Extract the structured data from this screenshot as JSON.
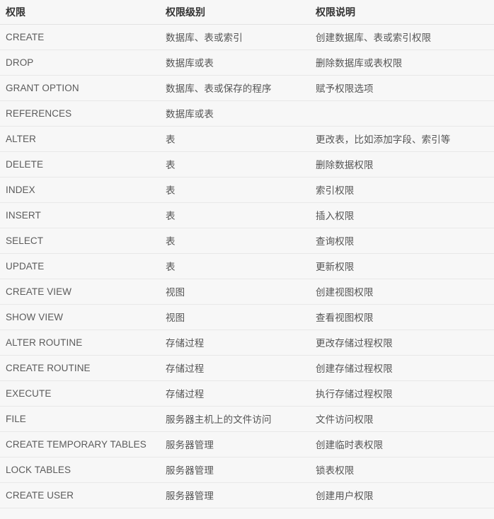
{
  "table": {
    "columns": [
      {
        "key": "privilege",
        "label": "权限"
      },
      {
        "key": "level",
        "label": "权限级别"
      },
      {
        "key": "description",
        "label": "权限说明"
      }
    ],
    "rows": [
      {
        "privilege": "CREATE",
        "level": "数据库、表或索引",
        "description": "创建数据库、表或索引权限"
      },
      {
        "privilege": "DROP",
        "level": "数据库或表",
        "description": "删除数据库或表权限"
      },
      {
        "privilege": "GRANT OPTION",
        "level": "数据库、表或保存的程序",
        "description": "赋予权限选项"
      },
      {
        "privilege": "REFERENCES",
        "level": "数据库或表",
        "description": ""
      },
      {
        "privilege": "ALTER",
        "level": "表",
        "description": "更改表，比如添加字段、索引等"
      },
      {
        "privilege": "DELETE",
        "level": "表",
        "description": "删除数据权限"
      },
      {
        "privilege": "INDEX",
        "level": "表",
        "description": "索引权限"
      },
      {
        "privilege": "INSERT",
        "level": "表",
        "description": "插入权限"
      },
      {
        "privilege": "SELECT",
        "level": "表",
        "description": "查询权限"
      },
      {
        "privilege": "UPDATE",
        "level": "表",
        "description": "更新权限"
      },
      {
        "privilege": "CREATE VIEW",
        "level": "视图",
        "description": "创建视图权限"
      },
      {
        "privilege": "SHOW VIEW",
        "level": "视图",
        "description": "查看视图权限"
      },
      {
        "privilege": "ALTER ROUTINE",
        "level": "存储过程",
        "description": "更改存储过程权限"
      },
      {
        "privilege": "CREATE ROUTINE",
        "level": "存储过程",
        "description": "创建存储过程权限"
      },
      {
        "privilege": "EXECUTE",
        "level": "存储过程",
        "description": "执行存储过程权限"
      },
      {
        "privilege": "FILE",
        "level": "服务器主机上的文件访问",
        "description": "文件访问权限"
      },
      {
        "privilege": "CREATE TEMPORARY TABLES",
        "level": "服务器管理",
        "description": "创建临时表权限"
      },
      {
        "privilege": "LOCK TABLES",
        "level": "服务器管理",
        "description": "锁表权限"
      },
      {
        "privilege": "CREATE USER",
        "level": "服务器管理",
        "description": "创建用户权限"
      }
    ]
  },
  "colors": {
    "background": "#f7f7f7",
    "header_text": "#333333",
    "body_text": "#555555",
    "header_rule": "#e3e3e3",
    "row_rule": "#e8e8e8"
  }
}
